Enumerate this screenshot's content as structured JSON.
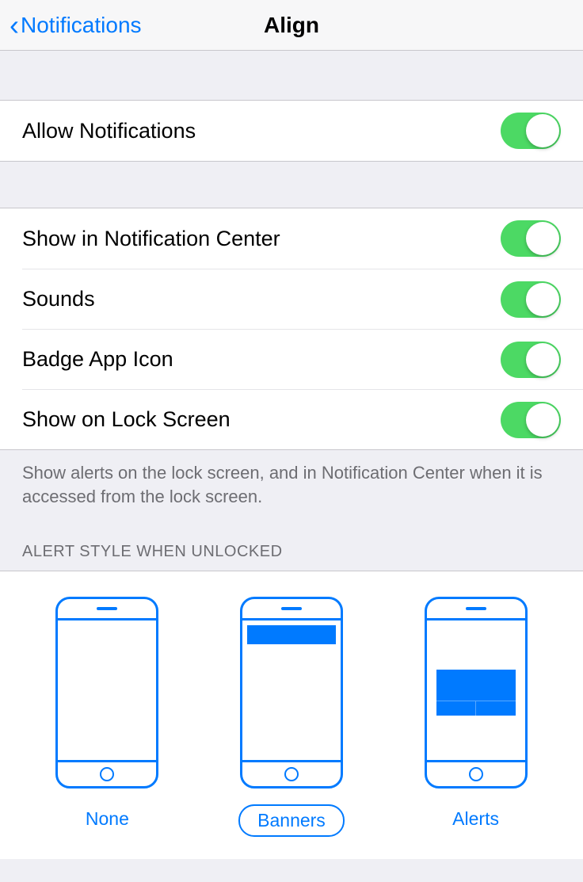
{
  "nav": {
    "back_label": "Notifications",
    "title": "Align"
  },
  "allow": {
    "label": "Allow Notifications",
    "on": true
  },
  "options": [
    {
      "label": "Show in Notification Center",
      "on": true
    },
    {
      "label": "Sounds",
      "on": true
    },
    {
      "label": "Badge App Icon",
      "on": true
    },
    {
      "label": "Show on Lock Screen",
      "on": true
    }
  ],
  "footer": "Show alerts on the lock screen, and in Notification Center when it is accessed from the lock screen.",
  "alert_style": {
    "header": "ALERT STYLE WHEN UNLOCKED",
    "options": {
      "none": "None",
      "banners": "Banners",
      "alerts": "Alerts"
    },
    "selected": "banners"
  }
}
